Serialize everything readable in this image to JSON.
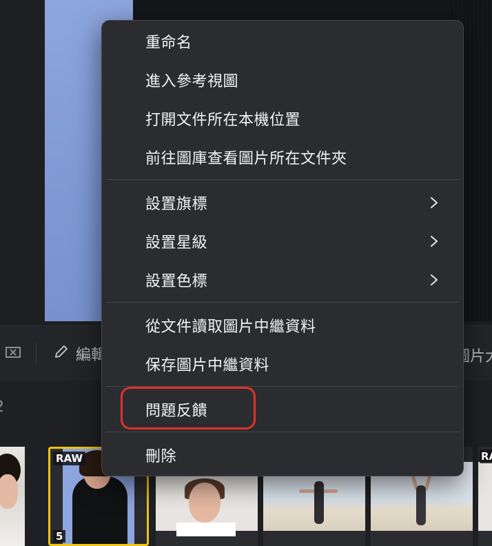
{
  "toolbar": {
    "flag_icon": "flag-x-icon",
    "edit_icon": "pencil-icon",
    "edit_label": "編輯",
    "right_label_partial": "圖片大"
  },
  "counter": {
    "text": "2"
  },
  "filmstrip": {
    "selected": {
      "raw_label": "RAW",
      "index_label": "5"
    },
    "last": {
      "raw_label": "RA"
    }
  },
  "context_menu": {
    "items": [
      {
        "label": "重命名"
      },
      {
        "label": "進入參考視圖"
      },
      {
        "label": "打開文件所在本機位置"
      },
      {
        "label": "前往圖庫查看圖片所在文件夾"
      },
      {
        "label": "設置旗標",
        "submenu": true
      },
      {
        "label": "設置星級",
        "submenu": true
      },
      {
        "label": "設置色標",
        "submenu": true
      },
      {
        "label": "從文件讀取圖片中繼資料"
      },
      {
        "label": "保存圖片中繼資料"
      },
      {
        "label": "問題反饋",
        "highlighted": true
      },
      {
        "label": "刪除"
      }
    ],
    "chevron_icon": "chevron-right-icon",
    "highlight_color": "#e0312c"
  },
  "colors": {
    "menu_bg": "#2b2c30",
    "selection_border": "#f1c40f",
    "photo_bg_blue": "#8ea6df"
  }
}
